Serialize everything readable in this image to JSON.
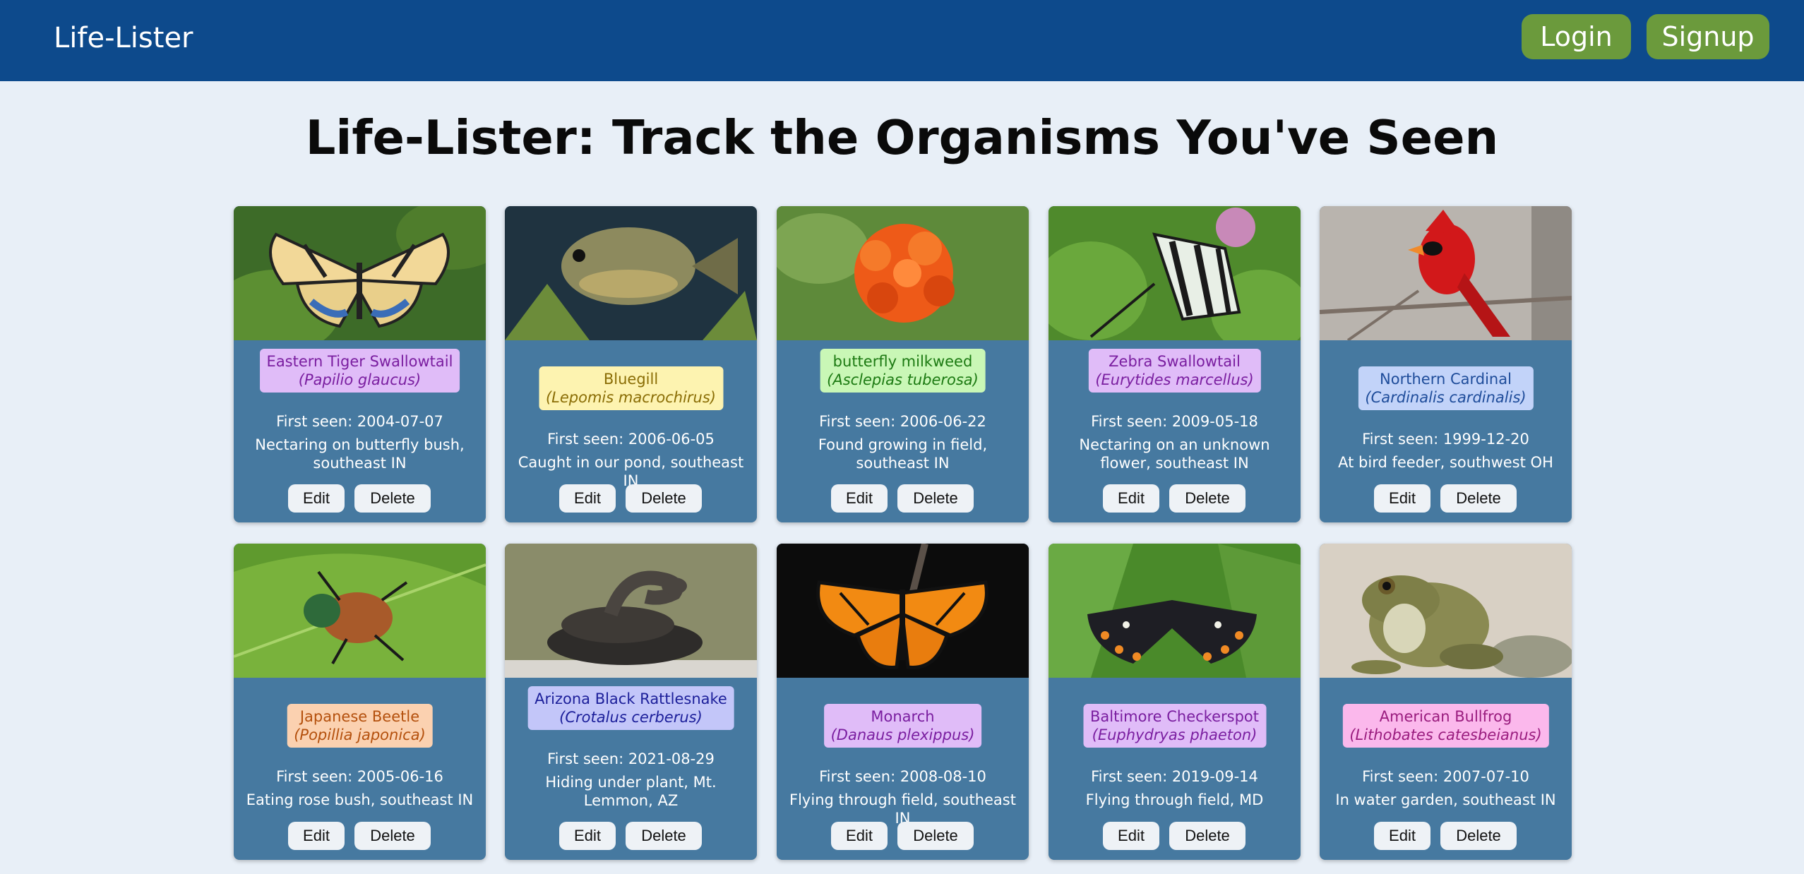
{
  "nav": {
    "brand": "Life-Lister",
    "login": "Login",
    "signup": "Signup"
  },
  "page_title": "Life-Lister: Track the Organisms You've Seen",
  "cards": [
    {
      "common": "Eastern Tiger Swallowtail",
      "scientific": "(Papilio glaucus)",
      "first_seen": "First seen: 2004-07-07",
      "location": "Nectaring on butterfly bush, southeast IN",
      "edit": "Edit",
      "delete": "Delete",
      "badge_bg": "#e0bcf8",
      "badge_fg": "#7a1ea0"
    },
    {
      "common": "Bluegill",
      "scientific": "(Lepomis macrochirus)",
      "first_seen": "First seen: 2006-06-05",
      "location": "Caught in our pond, southeast IN",
      "edit": "Edit",
      "delete": "Delete",
      "badge_bg": "#fdf3b0",
      "badge_fg": "#8a6d05"
    },
    {
      "common": "butterfly milkweed",
      "scientific": "(Asclepias tuberosa)",
      "first_seen": "First seen: 2006-06-22",
      "location": "Found growing in field, southeast IN",
      "edit": "Edit",
      "delete": "Delete",
      "badge_bg": "#c9f7b6",
      "badge_fg": "#1c7a12"
    },
    {
      "common": "Zebra Swallowtail",
      "scientific": "(Eurytides marcellus)",
      "first_seen": "First seen: 2009-05-18",
      "location": "Nectaring on an unknown flower, southeast IN",
      "edit": "Edit",
      "delete": "Delete",
      "badge_bg": "#e0bcf8",
      "badge_fg": "#7a1ea0"
    },
    {
      "common": "Northern Cardinal",
      "scientific": "(Cardinalis cardinalis)",
      "first_seen": "First seen: 1999-12-20",
      "location": "At bird feeder, southwest OH",
      "edit": "Edit",
      "delete": "Delete",
      "badge_bg": "#c2d3f9",
      "badge_fg": "#1e4c9a"
    },
    {
      "common": "Japanese Beetle",
      "scientific": "(Popillia japonica)",
      "first_seen": "First seen: 2005-06-16",
      "location": "Eating rose bush, southeast IN",
      "edit": "Edit",
      "delete": "Delete",
      "badge_bg": "#fbd1b0",
      "badge_fg": "#b4500d"
    },
    {
      "common": "Arizona Black Rattlesnake",
      "scientific": "(Crotalus cerberus)",
      "first_seen": "First seen: 2021-08-29",
      "location": "Hiding under plant, Mt. Lemmon, AZ",
      "edit": "Edit",
      "delete": "Delete",
      "badge_bg": "#c3c6f9",
      "badge_fg": "#1c1f9a"
    },
    {
      "common": "Monarch",
      "scientific": "(Danaus plexippus)",
      "first_seen": "First seen: 2008-08-10",
      "location": "Flying through field, southeast IN",
      "edit": "Edit",
      "delete": "Delete",
      "badge_bg": "#e0bcf8",
      "badge_fg": "#7a1ea0"
    },
    {
      "common": "Baltimore Checkerspot",
      "scientific": "(Euphydryas phaeton)",
      "first_seen": "First seen: 2019-09-14",
      "location": "Flying through field, MD",
      "edit": "Edit",
      "delete": "Delete",
      "badge_bg": "#e0bcf8",
      "badge_fg": "#7a1ea0"
    },
    {
      "common": "American Bullfrog",
      "scientific": "(Lithobates catesbeianus)",
      "first_seen": "First seen: 2007-07-10",
      "location": "In water garden, southeast IN",
      "edit": "Edit",
      "delete": "Delete",
      "badge_bg": "#fbb8ec",
      "badge_fg": "#9a1c7e"
    }
  ]
}
